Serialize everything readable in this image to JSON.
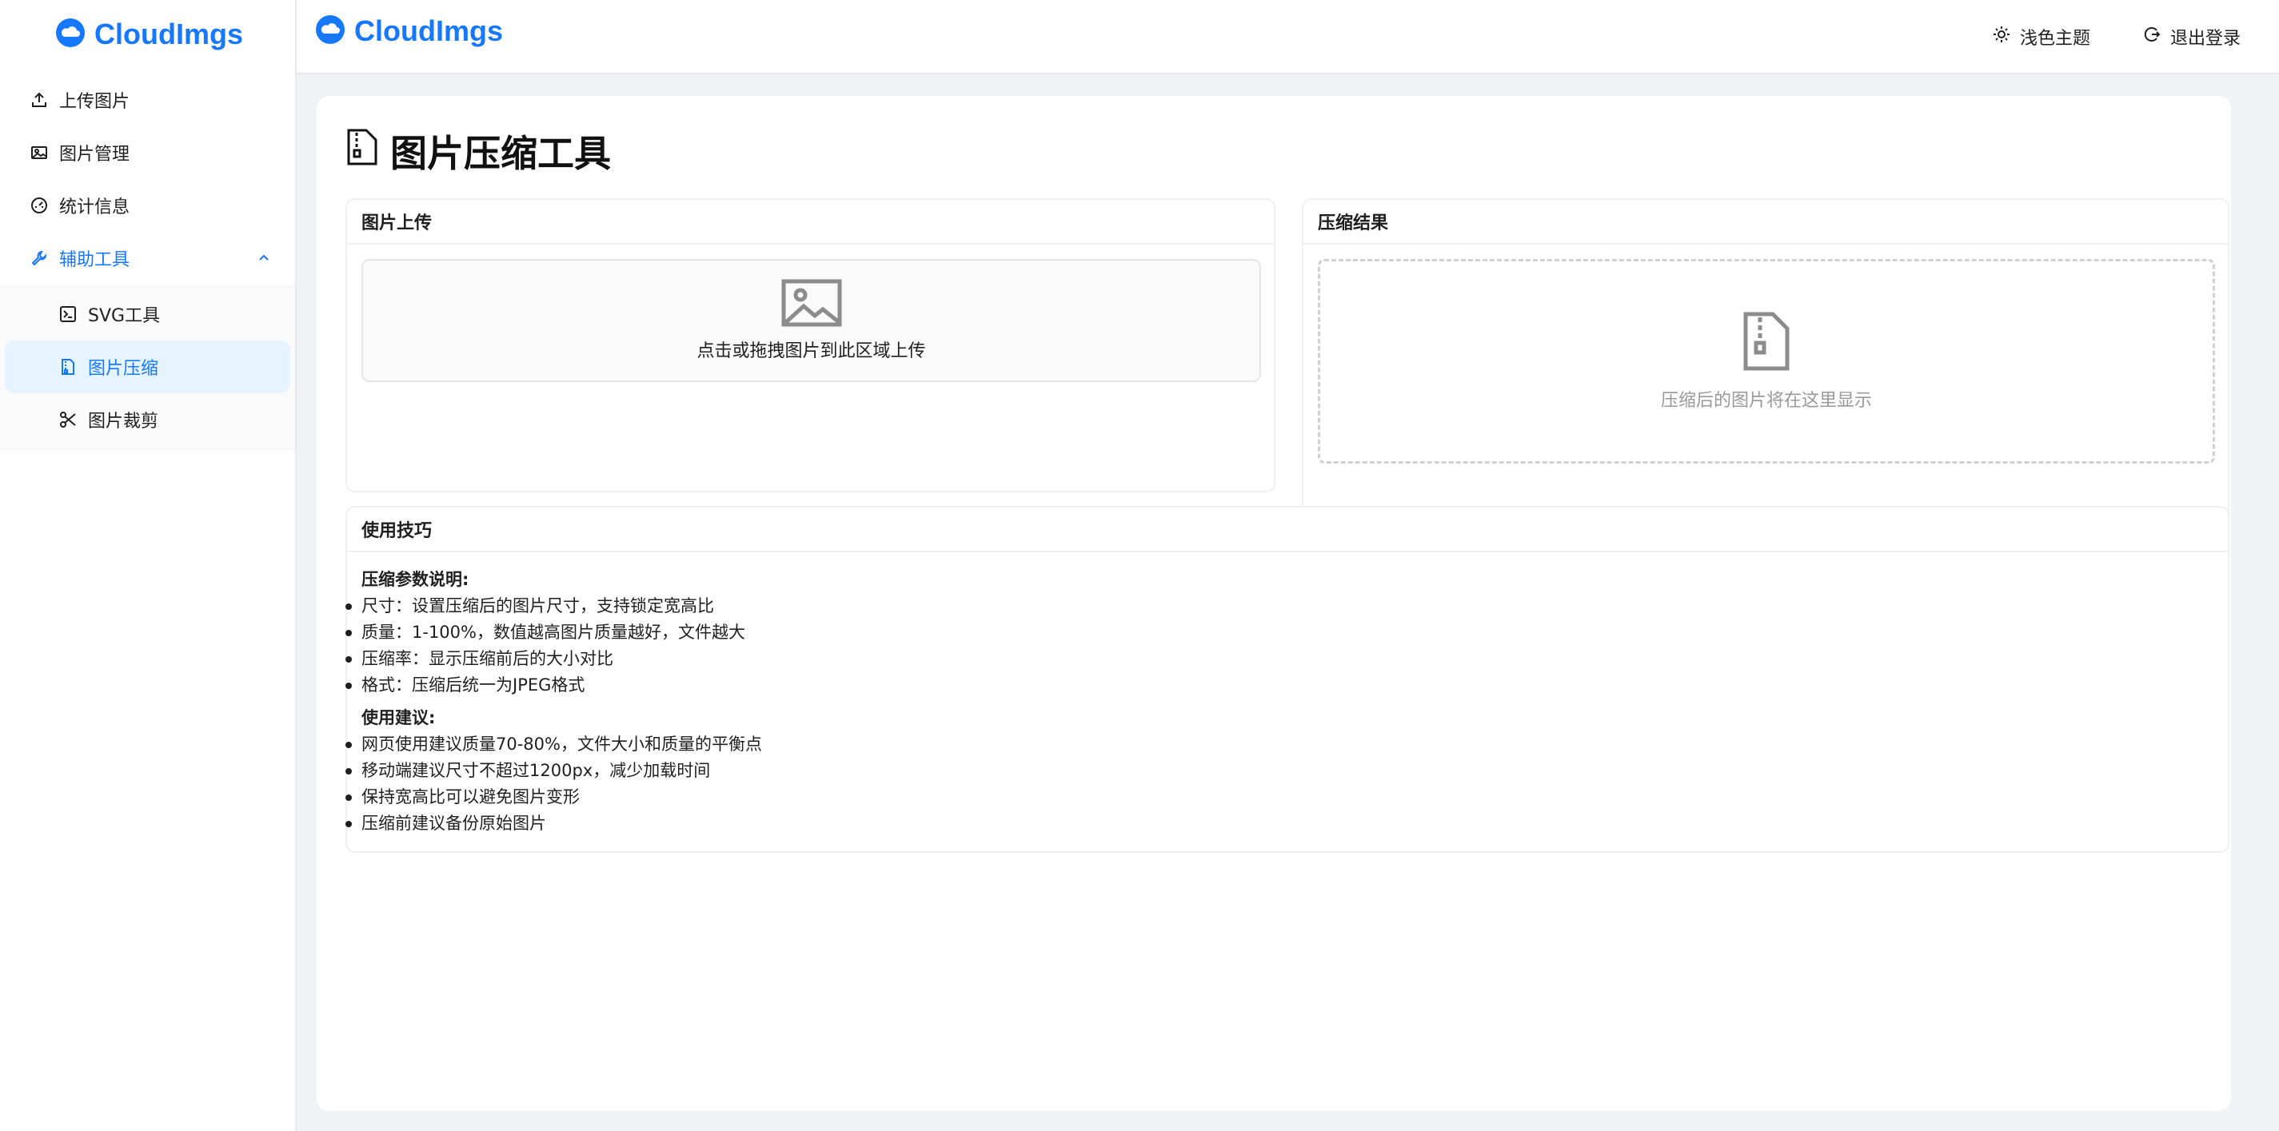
{
  "brand": {
    "name": "CloudImgs",
    "accent": "#1677ff"
  },
  "sidebar": {
    "items": [
      {
        "label": "上传图片",
        "icon": "upload-icon"
      },
      {
        "label": "图片管理",
        "icon": "image-icon"
      },
      {
        "label": "统计信息",
        "icon": "dashboard-icon"
      }
    ],
    "tools": {
      "label": "辅助工具",
      "icon": "tool-icon",
      "expanded": true,
      "children": [
        {
          "label": "SVG工具",
          "icon": "code-icon"
        },
        {
          "label": "图片压缩",
          "icon": "file-zip-icon",
          "active": true
        },
        {
          "label": "图片裁剪",
          "icon": "scissor-icon"
        }
      ]
    }
  },
  "header": {
    "theme_label": "浅色主题",
    "logout_label": "退出登录"
  },
  "page": {
    "title": "图片压缩工具",
    "upload": {
      "title": "图片上传",
      "hint": "点击或拖拽图片到此区域上传"
    },
    "result": {
      "title": "压缩结果",
      "placeholder": "压缩后的图片将在这里显示"
    },
    "tips": {
      "title": "使用技巧",
      "params_heading": "压缩参数说明:",
      "params": [
        "尺寸：设置压缩后的图片尺寸，支持锁定宽高比",
        "质量：1-100%，数值越高图片质量越好，文件越大",
        "压缩率：显示压缩前后的大小对比",
        "格式：压缩后统一为JPEG格式"
      ],
      "advice_heading": "使用建议:",
      "advice": [
        "网页使用建议质量70-80%，文件大小和质量的平衡点",
        "移动端建议尺寸不超过1200px，减少加载时间",
        "保持宽高比可以避免图片变形",
        "压缩前建议备份原始图片"
      ]
    }
  }
}
